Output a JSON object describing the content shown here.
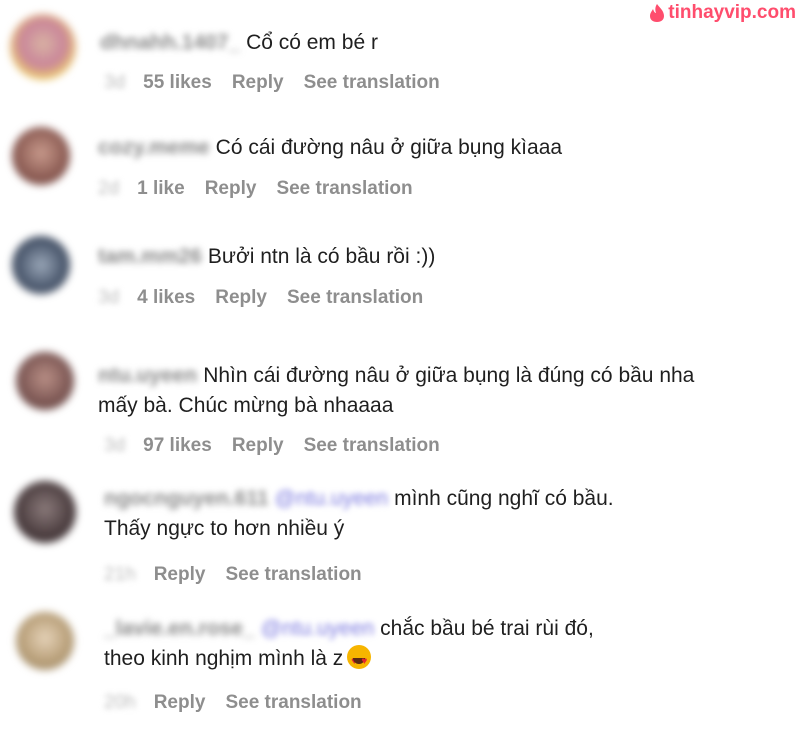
{
  "watermark": {
    "text": "tinhayvip.com"
  },
  "comments": [
    {
      "username": "dhnahh.1407_",
      "text": "Cổ có em bé r",
      "time": "3d",
      "likes": "55 likes",
      "reply": "Reply",
      "translate": "See translation"
    },
    {
      "username": "cozy.meme",
      "text": "Có cái đường nâu ở giữa bụng kìaaa",
      "time": "2d",
      "likes": "1 like",
      "reply": "Reply",
      "translate": "See translation"
    },
    {
      "username": "tam.mm26",
      "text": "Bưởi ntn là có bầu rồi :))",
      "time": "3d",
      "likes": "4 likes",
      "reply": "Reply",
      "translate": "See translation"
    },
    {
      "username": "ntu.uyeen",
      "text_line1": "Nhìn cái đường nâu ở giữa bụng là đúng có bầu nha",
      "text_line2": "mấy bà. Chúc mừng bà nhaaaa",
      "time": "3d",
      "likes": "97 likes",
      "reply": "Reply",
      "translate": "See translation"
    },
    {
      "username": "ngocnguyen.611",
      "mention": "@ntu.uyeen",
      "text_line1": "mình cũng nghĩ có bầu.",
      "text_line2": "Thấy ngực to hơn nhiều ý",
      "time": "21h",
      "reply": "Reply",
      "translate": "See translation"
    },
    {
      "username": "_lavie.en.rose_",
      "mention": "@ntu.uyeen",
      "text_line1": "chắc bầu bé trai rùi đó,",
      "text_line2": "theo kinh nghịm mình là z",
      "emoji": "heart-eyes-emoji",
      "time": "20h",
      "reply": "Reply",
      "translate": "See translation"
    }
  ]
}
